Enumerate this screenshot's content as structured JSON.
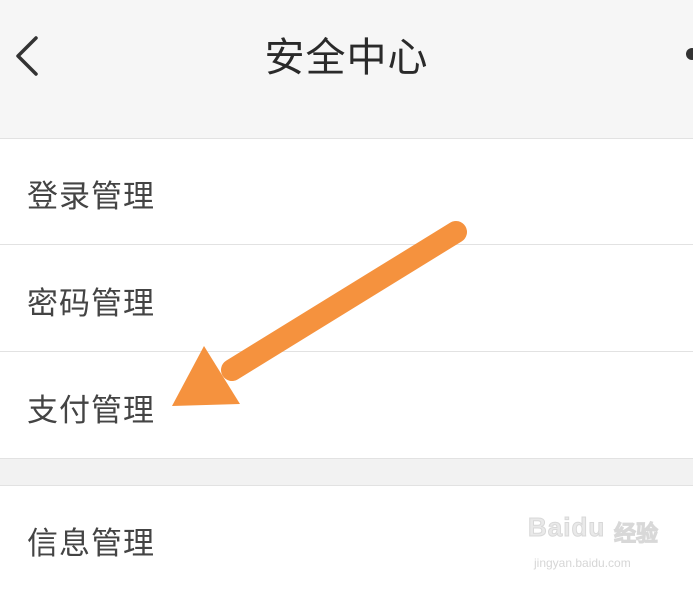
{
  "nav": {
    "title": "安全中心",
    "back_icon": "chevron-left-icon",
    "more_icon": "more-icon"
  },
  "menu": {
    "items": [
      {
        "label": "登录管理"
      },
      {
        "label": "密码管理"
      },
      {
        "label": "支付管理"
      },
      {
        "label": "信息管理"
      }
    ]
  },
  "annotation": {
    "arrow_color": "#f5923e",
    "points_to": "支付管理"
  },
  "watermark": {
    "brand": "Bai",
    "brand_suffix": "du",
    "cn": "经验",
    "url": "jingyan.baidu.com"
  },
  "colors": {
    "nav_background": "#f6f6f6",
    "separator": "#e2e2e2",
    "text": "#444444",
    "title": "#2a2a2a"
  }
}
